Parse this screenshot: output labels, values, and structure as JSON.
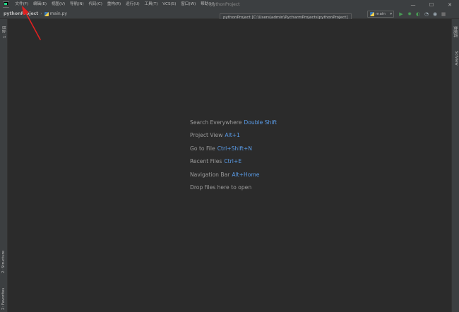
{
  "menu": {
    "items": [
      "文件(F)",
      "编辑(E)",
      "视图(V)",
      "导航(N)",
      "代码(C)",
      "重构(R)",
      "运行(U)",
      "工具(T)",
      "VCS(S)",
      "窗口(W)",
      "帮助(H)"
    ]
  },
  "window_title": "pythonProject",
  "window_controls": {
    "minimize": "—",
    "maximize": "☐",
    "close": "✕"
  },
  "navbar": {
    "project": "pythonProject",
    "separator": "›",
    "file": "main.py"
  },
  "tooltip": "pythonProject [C:\\Users\\admin\\PycharmProjects\\pythonProject]",
  "run_config": {
    "name": "main",
    "caret": "▾"
  },
  "nav_actions": [
    {
      "icon": "run-icon",
      "glyph": "▶",
      "color": "#499c54"
    },
    {
      "icon": "debug-icon",
      "glyph": "✹",
      "color": "#499c54"
    },
    {
      "icon": "coverage-icon",
      "glyph": "◐",
      "color": "#499c54"
    },
    {
      "icon": "profile-icon",
      "glyph": "◔",
      "color": "#9aa7b0"
    },
    {
      "icon": "concurrency-icon",
      "glyph": "◉",
      "color": "#9aa7b0"
    },
    {
      "icon": "stop-icon",
      "glyph": "■",
      "color": "#6e6e6e"
    }
  ],
  "left_tabs": {
    "project": "1: 项目",
    "structure": "2: Structure",
    "favorites": "2: Favorites"
  },
  "right_tabs": {
    "database": "数据库",
    "sciview": "SciView"
  },
  "hints": [
    {
      "label": "Search Everywhere",
      "key": "Double Shift"
    },
    {
      "label": "Project View",
      "key": "Alt+1"
    },
    {
      "label": "Go to File",
      "key": "Ctrl+Shift+N"
    },
    {
      "label": "Recent Files",
      "key": "Ctrl+E"
    },
    {
      "label": "Navigation Bar",
      "key": "Alt+Home"
    },
    {
      "label": "Drop files here to open",
      "key": ""
    }
  ],
  "colors": {
    "accent": "#5a9ce8",
    "annotation": "#e02020"
  }
}
